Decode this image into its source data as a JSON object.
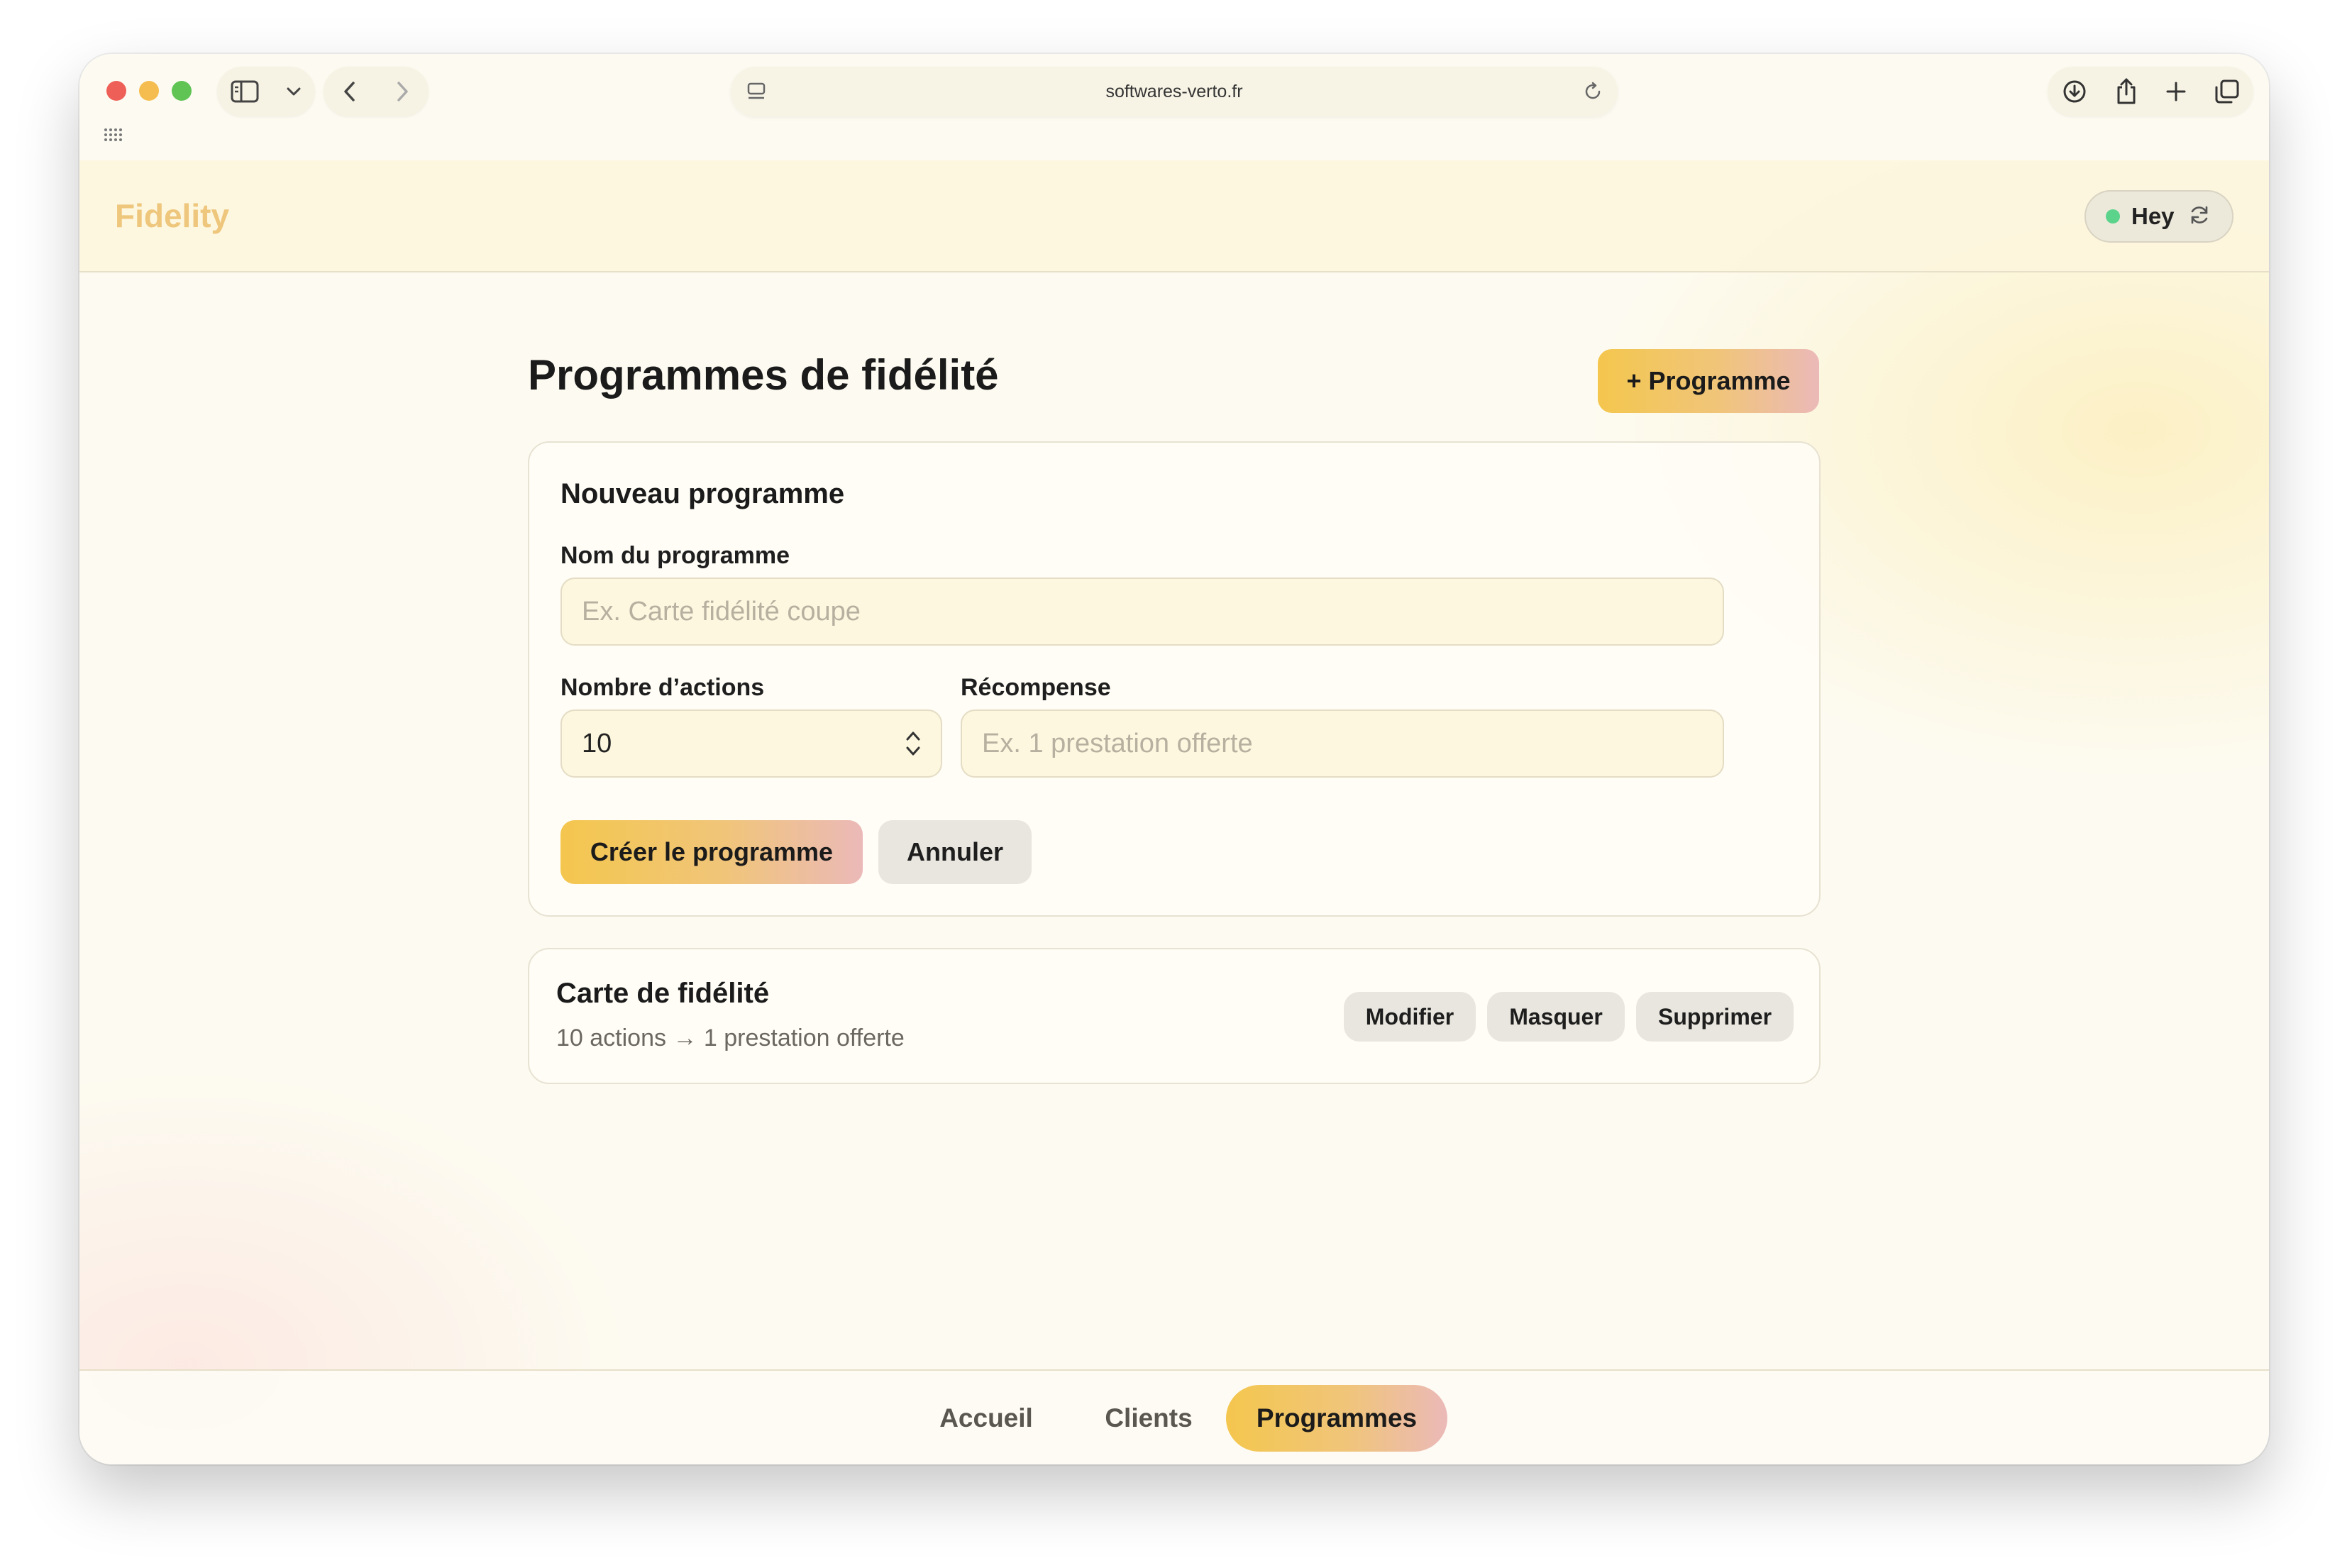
{
  "browser": {
    "url": "softwares-verto.fr"
  },
  "app": {
    "brand": "Fidelity",
    "user": {
      "name": "Hey"
    }
  },
  "page": {
    "title": "Programmes de fidélité",
    "add_button": "+ Programme"
  },
  "form": {
    "title": "Nouveau programme",
    "name_label": "Nom du programme",
    "name_placeholder": "Ex. Carte fidélité coupe",
    "actions_label": "Nombre d’actions",
    "actions_value": "10",
    "reward_label": "Récompense",
    "reward_placeholder": "Ex. 1 prestation offerte",
    "create_button": "Créer le programme",
    "cancel_button": "Annuler"
  },
  "programs": [
    {
      "name": "Carte de fidélité",
      "description": "10 actions → 1 prestation offerte",
      "edit_button": "Modifier",
      "hide_button": "Masquer",
      "delete_button": "Supprimer"
    }
  ],
  "nav": {
    "items": [
      {
        "label": "Accueil",
        "active": false
      },
      {
        "label": "Clients",
        "active": false
      },
      {
        "label": "Programmes",
        "active": true
      }
    ]
  },
  "colors": {
    "brand": "#eec67c",
    "status_online": "#5cd38b",
    "accent_start": "#f4c64e",
    "accent_end": "#ebb9b8"
  },
  "icons": [
    "sidebar-icon",
    "chevron-down-icon",
    "back-icon",
    "forward-icon",
    "site-icon",
    "reload-icon",
    "download-icon",
    "share-icon",
    "plus-icon",
    "tabs-icon",
    "grid-icon",
    "sync-icon",
    "stepper-icon"
  ]
}
